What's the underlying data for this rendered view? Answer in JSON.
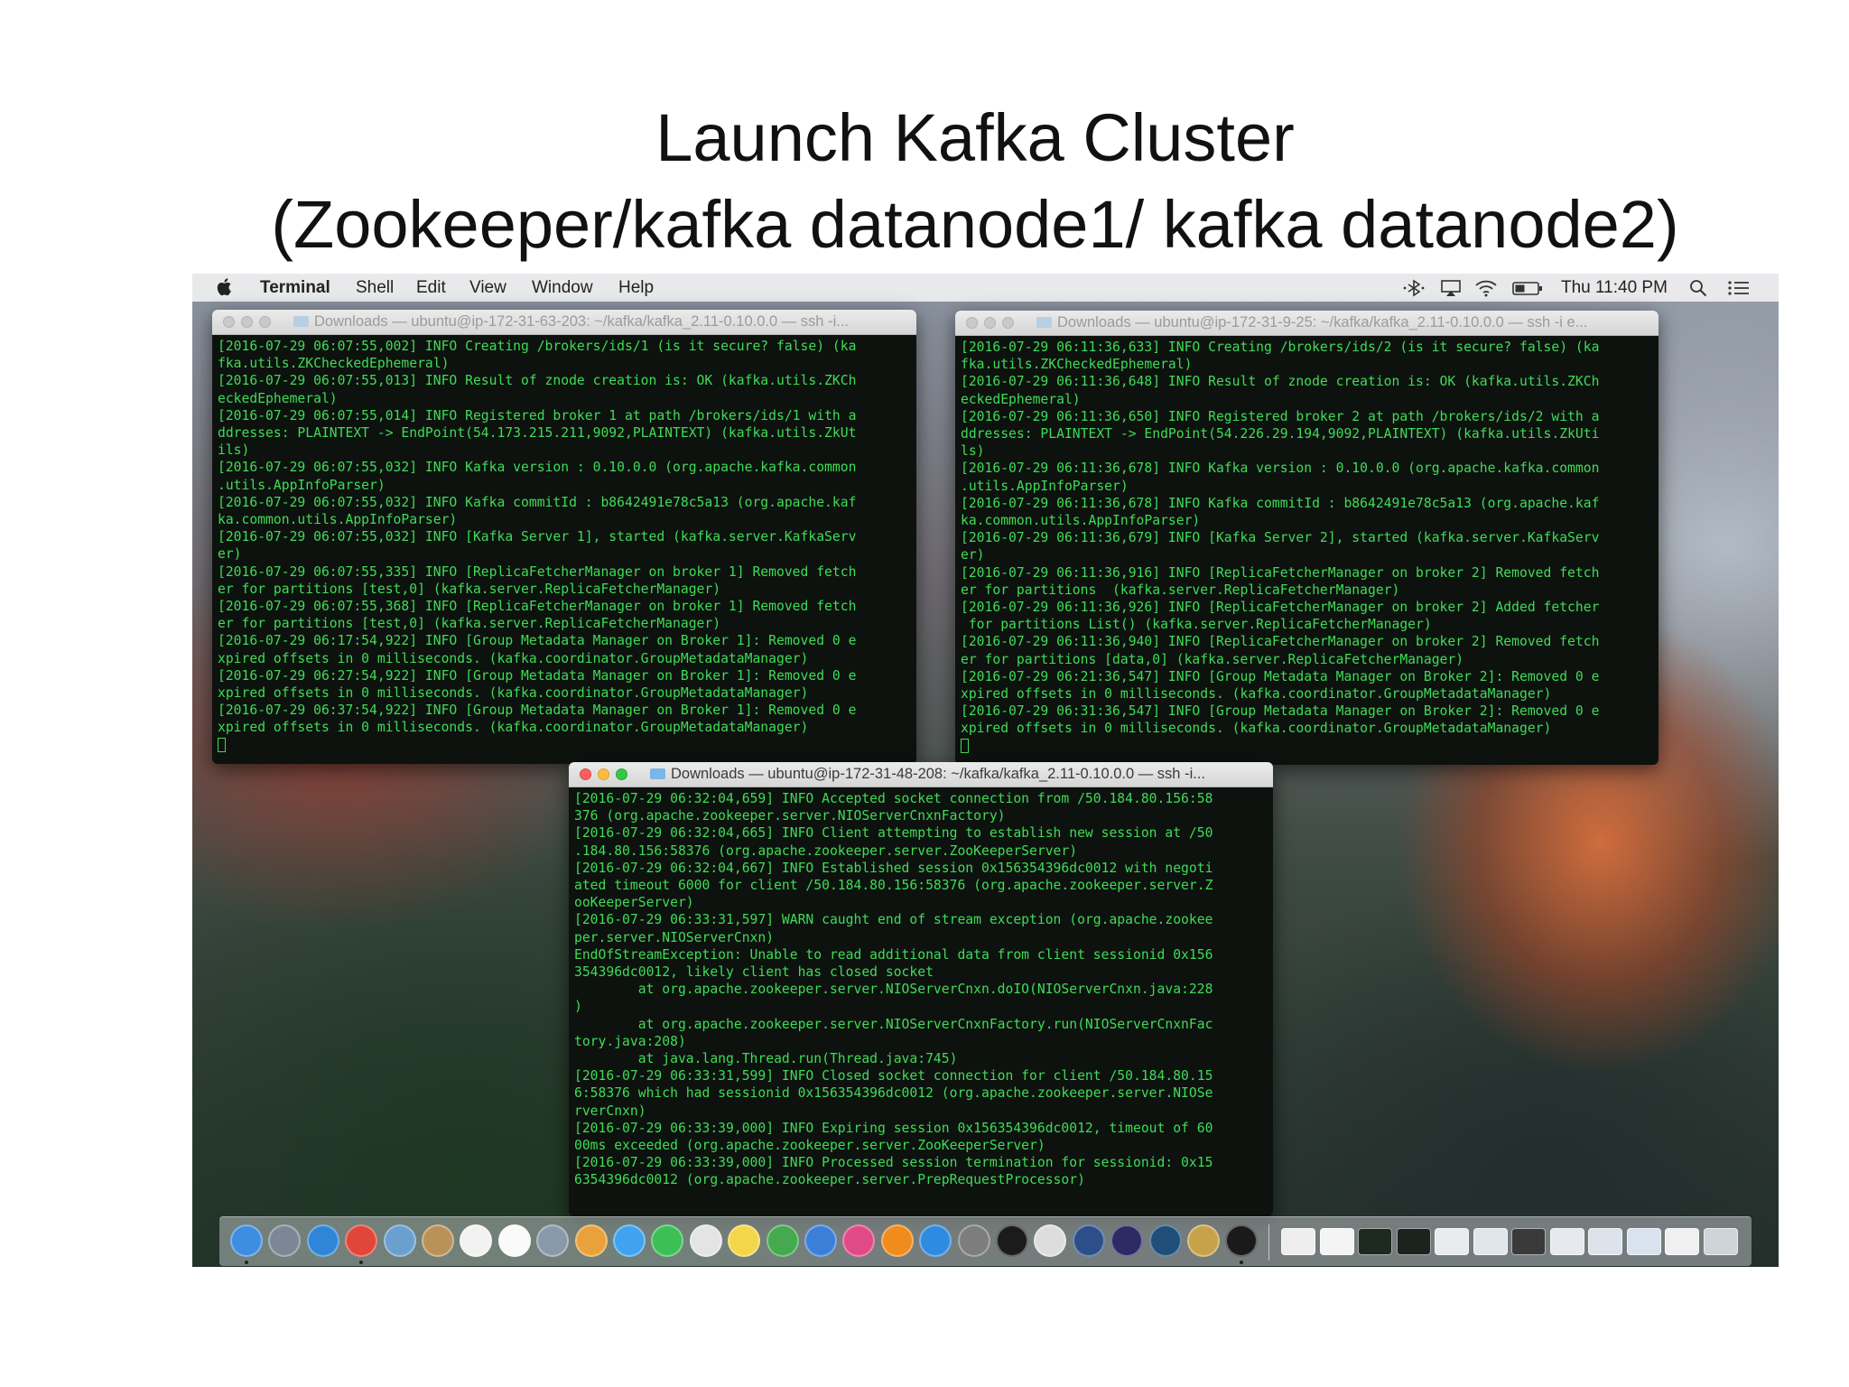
{
  "slide": {
    "title_line1": "Launch Kafka Cluster",
    "title_line2": "(Zookeeper/kafka datanode1/ kafka datanode2)"
  },
  "menubar": {
    "app_name": "Terminal",
    "items": [
      "Shell",
      "Edit",
      "View",
      "Window",
      "Help"
    ],
    "clock": "Thu 11:40 PM",
    "icons": [
      "apple-icon",
      "bluetooth-icon",
      "airplay-icon",
      "wifi-icon",
      "battery-icon",
      "spotlight-search-icon",
      "notification-center-icon"
    ]
  },
  "windows": {
    "broker1": {
      "title": "Downloads — ubuntu@ip-172-31-63-203: ~/kafka/kafka_2.11-0.10.0.0 — ssh -i...",
      "lines": [
        "[2016-07-29 06:07:55,002] INFO Creating /brokers/ids/1 (is it secure? false) (ka",
        "fka.utils.ZKCheckedEphemeral)",
        "[2016-07-29 06:07:55,013] INFO Result of znode creation is: OK (kafka.utils.ZKCh",
        "eckedEphemeral)",
        "[2016-07-29 06:07:55,014] INFO Registered broker 1 at path /brokers/ids/1 with a",
        "ddresses: PLAINTEXT -> EndPoint(54.173.215.211,9092,PLAINTEXT) (kafka.utils.ZkUt",
        "ils)",
        "[2016-07-29 06:07:55,032] INFO Kafka version : 0.10.0.0 (org.apache.kafka.common",
        ".utils.AppInfoParser)",
        "[2016-07-29 06:07:55,032] INFO Kafka commitId : b8642491e78c5a13 (org.apache.kaf",
        "ka.common.utils.AppInfoParser)",
        "[2016-07-29 06:07:55,032] INFO [Kafka Server 1], started (kafka.server.KafkaServ",
        "er)",
        "[2016-07-29 06:07:55,335] INFO [ReplicaFetcherManager on broker 1] Removed fetch",
        "er for partitions [test,0] (kafka.server.ReplicaFetcherManager)",
        "[2016-07-29 06:07:55,368] INFO [ReplicaFetcherManager on broker 1] Removed fetch",
        "er for partitions [test,0] (kafka.server.ReplicaFetcherManager)",
        "[2016-07-29 06:17:54,922] INFO [Group Metadata Manager on Broker 1]: Removed 0 e",
        "xpired offsets in 0 milliseconds. (kafka.coordinator.GroupMetadataManager)",
        "[2016-07-29 06:27:54,922] INFO [Group Metadata Manager on Broker 1]: Removed 0 e",
        "xpired offsets in 0 milliseconds. (kafka.coordinator.GroupMetadataManager)",
        "[2016-07-29 06:37:54,922] INFO [Group Metadata Manager on Broker 1]: Removed 0 e",
        "xpired offsets in 0 milliseconds. (kafka.coordinator.GroupMetadataManager)"
      ]
    },
    "broker2": {
      "title": "Downloads — ubuntu@ip-172-31-9-25: ~/kafka/kafka_2.11-0.10.0.0 — ssh -i e...",
      "lines": [
        "[2016-07-29 06:11:36,633] INFO Creating /brokers/ids/2 (is it secure? false) (ka",
        "fka.utils.ZKCheckedEphemeral)",
        "[2016-07-29 06:11:36,648] INFO Result of znode creation is: OK (kafka.utils.ZKCh",
        "eckedEphemeral)",
        "[2016-07-29 06:11:36,650] INFO Registered broker 2 at path /brokers/ids/2 with a",
        "ddresses: PLAINTEXT -> EndPoint(54.226.29.194,9092,PLAINTEXT) (kafka.utils.ZkUti",
        "ls)",
        "[2016-07-29 06:11:36,678] INFO Kafka version : 0.10.0.0 (org.apache.kafka.common",
        ".utils.AppInfoParser)",
        "[2016-07-29 06:11:36,678] INFO Kafka commitId : b8642491e78c5a13 (org.apache.kaf",
        "ka.common.utils.AppInfoParser)",
        "[2016-07-29 06:11:36,679] INFO [Kafka Server 2], started (kafka.server.KafkaServ",
        "er)",
        "[2016-07-29 06:11:36,916] INFO [ReplicaFetcherManager on broker 2] Removed fetch",
        "er for partitions  (kafka.server.ReplicaFetcherManager)",
        "[2016-07-29 06:11:36,926] INFO [ReplicaFetcherManager on broker 2] Added fetcher",
        " for partitions List() (kafka.server.ReplicaFetcherManager)",
        "[2016-07-29 06:11:36,940] INFO [ReplicaFetcherManager on broker 2] Removed fetch",
        "er for partitions [data,0] (kafka.server.ReplicaFetcherManager)",
        "[2016-07-29 06:21:36,547] INFO [Group Metadata Manager on Broker 2]: Removed 0 e",
        "xpired offsets in 0 milliseconds. (kafka.coordinator.GroupMetadataManager)",
        "[2016-07-29 06:31:36,547] INFO [Group Metadata Manager on Broker 2]: Removed 0 e",
        "xpired offsets in 0 milliseconds. (kafka.coordinator.GroupMetadataManager)"
      ]
    },
    "zookeeper": {
      "title": "Downloads — ubuntu@ip-172-31-48-208: ~/kafka/kafka_2.11-0.10.0.0 — ssh -i...",
      "lines": [
        "[2016-07-29 06:32:04,659] INFO Accepted socket connection from /50.184.80.156:58",
        "376 (org.apache.zookeeper.server.NIOServerCnxnFactory)",
        "[2016-07-29 06:32:04,665] INFO Client attempting to establish new session at /50",
        ".184.80.156:58376 (org.apache.zookeeper.server.ZooKeeperServer)",
        "[2016-07-29 06:32:04,667] INFO Established session 0x156354396dc0012 with negoti",
        "ated timeout 6000 for client /50.184.80.156:58376 (org.apache.zookeeper.server.Z",
        "ooKeeperServer)",
        "[2016-07-29 06:33:31,597] WARN caught end of stream exception (org.apache.zookee",
        "per.server.NIOServerCnxn)",
        "EndOfStreamException: Unable to read additional data from client sessionid 0x156",
        "354396dc0012, likely client has closed socket",
        "        at org.apache.zookeeper.server.NIOServerCnxn.doIO(NIOServerCnxn.java:228",
        ")",
        "        at org.apache.zookeeper.server.NIOServerCnxnFactory.run(NIOServerCnxnFac",
        "tory.java:208)",
        "        at java.lang.Thread.run(Thread.java:745)",
        "[2016-07-29 06:33:31,599] INFO Closed socket connection for client /50.184.80.15",
        "6:58376 which had sessionid 0x156354396dc0012 (org.apache.zookeeper.server.NIOSe",
        "rverCnxn)",
        "[2016-07-29 06:33:39,000] INFO Expiring session 0x156354396dc0012, timeout of 60",
        "00ms exceeded (org.apache.zookeeper.server.ZooKeeperServer)",
        "[2016-07-29 06:33:39,000] INFO Processed session termination for sessionid: 0x15",
        "6354396dc0012 (org.apache.zookeeper.server.PrepRequestProcessor)"
      ]
    }
  },
  "dock": {
    "apps": [
      {
        "icon": "finder-icon",
        "color": "#3d8ee0"
      },
      {
        "icon": "launchpad-icon",
        "color": "#7c8796"
      },
      {
        "icon": "safari-icon",
        "color": "#2f86d8"
      },
      {
        "icon": "chrome-icon",
        "color": "#e0463a"
      },
      {
        "icon": "preview-icon",
        "color": "#6a9fd0"
      },
      {
        "icon": "contacts-icon",
        "color": "#b9925a"
      },
      {
        "icon": "calendar-icon",
        "color": "#f2f2f2"
      },
      {
        "icon": "reminders-icon",
        "color": "#fafafa"
      },
      {
        "icon": "photo-booth-icon",
        "color": "#8a99aa"
      },
      {
        "icon": "photos-icon",
        "color": "#e9a23b"
      },
      {
        "icon": "messages-icon",
        "color": "#3fa3ef"
      },
      {
        "icon": "facetime-icon",
        "color": "#3cbf55"
      },
      {
        "icon": "textedit-icon",
        "color": "#e4e4e4"
      },
      {
        "icon": "notes-icon",
        "color": "#f4d64a"
      },
      {
        "icon": "numbers-icon",
        "color": "#44a94f"
      },
      {
        "icon": "keynote-icon",
        "color": "#3b7fd9"
      },
      {
        "icon": "itunes-icon",
        "color": "#e04a86"
      },
      {
        "icon": "ibooks-icon",
        "color": "#f08c1e"
      },
      {
        "icon": "app-store-icon",
        "color": "#2f8be0"
      },
      {
        "icon": "system-preferences-icon",
        "color": "#7d7d7d"
      },
      {
        "icon": "intellij-icon",
        "color": "#1b1b1b"
      },
      {
        "icon": "script-editor-icon",
        "color": "#dddddd"
      },
      {
        "icon": "webstorm-icon",
        "color": "#2c4f8a"
      },
      {
        "icon": "eclipse-icon",
        "color": "#2c2b63"
      },
      {
        "icon": "vpn-icon",
        "color": "#1f4e7a"
      },
      {
        "icon": "pen-icon",
        "color": "#c8a24a"
      },
      {
        "icon": "terminal-icon",
        "color": "#1a1a1a"
      }
    ],
    "docs": [
      {
        "icon": "document-icon",
        "color": "#eeeeee"
      },
      {
        "icon": "minimized-window-icon",
        "color": "#f4f4f4"
      },
      {
        "icon": "minimized-terminal-icon",
        "color": "#1e2a20"
      },
      {
        "icon": "minimized-terminal-icon",
        "color": "#1c221e"
      },
      {
        "icon": "minimized-window-icon",
        "color": "#e8ecef"
      },
      {
        "icon": "minimized-window-icon",
        "color": "#dfe6ec"
      },
      {
        "icon": "minimized-window-icon",
        "color": "#3a3a3a"
      },
      {
        "icon": "minimized-window-icon",
        "color": "#e6e9ee"
      },
      {
        "icon": "minimized-window-icon",
        "color": "#dde3ea"
      },
      {
        "icon": "minimized-window-icon",
        "color": "#d9e3ef"
      },
      {
        "icon": "minimized-window-icon",
        "color": "#f0f0f0"
      },
      {
        "icon": "trash-icon",
        "color": "#cfd4d8"
      }
    ]
  }
}
